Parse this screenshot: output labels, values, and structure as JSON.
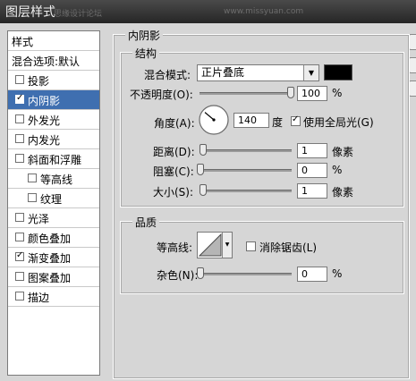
{
  "window": {
    "title": "图层样式",
    "watermark_left": "思缘设计论坛",
    "watermark_right": "www.missyuan.com"
  },
  "sidebar": {
    "items": [
      {
        "label": "样式",
        "type": "header"
      },
      {
        "label": "混合选项:默认",
        "type": "header"
      },
      {
        "label": "投影",
        "checked": false
      },
      {
        "label": "内阴影",
        "checked": true,
        "selected": true
      },
      {
        "label": "外发光",
        "checked": false
      },
      {
        "label": "内发光",
        "checked": false
      },
      {
        "label": "斜面和浮雕",
        "checked": false
      },
      {
        "label": "等高线",
        "checked": false,
        "indent": true
      },
      {
        "label": "纹理",
        "checked": false,
        "indent": true
      },
      {
        "label": "光泽",
        "checked": false
      },
      {
        "label": "颜色叠加",
        "checked": false
      },
      {
        "label": "渐变叠加",
        "checked": true
      },
      {
        "label": "图案叠加",
        "checked": false
      },
      {
        "label": "描边",
        "checked": false
      }
    ]
  },
  "panel": {
    "title": "内阴影",
    "structure": {
      "title": "结构",
      "blend_mode_label": "混合模式:",
      "blend_mode_value": "正片叠底",
      "opacity_label": "不透明度(O):",
      "opacity_value": "100",
      "opacity_unit": "%",
      "opacity_fraction": 1.0,
      "angle_label": "角度(A):",
      "angle_value": "140",
      "angle_unit": "度",
      "global_light_label": "使用全局光(G)",
      "global_light_checked": true,
      "distance_label": "距离(D):",
      "distance_value": "1",
      "distance_unit": "像素",
      "choke_label": "阻塞(C):",
      "choke_value": "0",
      "choke_unit": "%",
      "size_label": "大小(S):",
      "size_value": "1",
      "size_unit": "像素"
    },
    "quality": {
      "title": "品质",
      "contour_label": "等高线:",
      "antialias_label": "消除锯齿(L)",
      "antialias_checked": false,
      "noise_label": "杂色(N):",
      "noise_value": "0",
      "noise_unit": "%"
    }
  },
  "colors": {
    "shadow_color": "#000000",
    "selection": "#3f6fb0"
  }
}
